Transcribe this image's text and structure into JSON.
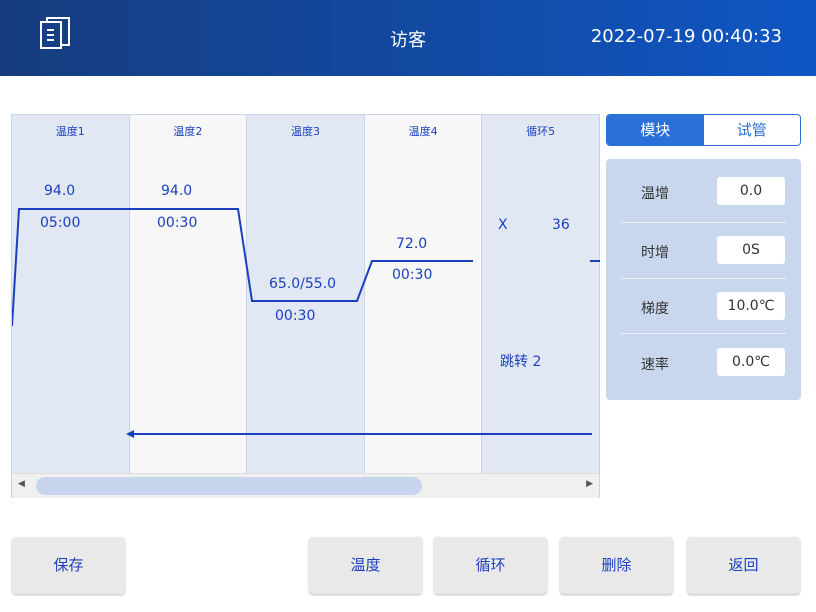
{
  "header": {
    "title": "访客",
    "datetime": "2022-07-19 00:40:33"
  },
  "steps": [
    {
      "name": "温度1",
      "temp": "94.0",
      "time": "05:00"
    },
    {
      "name": "温度2",
      "temp": "94.0",
      "time": "00:30"
    },
    {
      "name": "温度3",
      "temp": "65.0/55.0",
      "time": "00:30"
    },
    {
      "name": "温度4",
      "temp": "72.0",
      "time": "00:30"
    },
    {
      "name": "循环5",
      "x": "X",
      "count": "36",
      "jump": "跳转 2"
    }
  ],
  "tabs": [
    "模块",
    "试管"
  ],
  "settings": [
    {
      "label": "温增",
      "value": "0.0"
    },
    {
      "label": "时增",
      "value": "0S"
    },
    {
      "label": "梯度",
      "value": "10.0℃"
    },
    {
      "label": "速率",
      "value": "0.0℃"
    }
  ],
  "buttons": {
    "save": "保存",
    "temp": "温度",
    "cycle": "循环",
    "delete": "删除",
    "back": "返回"
  },
  "colors": {
    "header": "#0f56c4",
    "accent": "#2b6fd8",
    "line": "#1a3fbf"
  }
}
